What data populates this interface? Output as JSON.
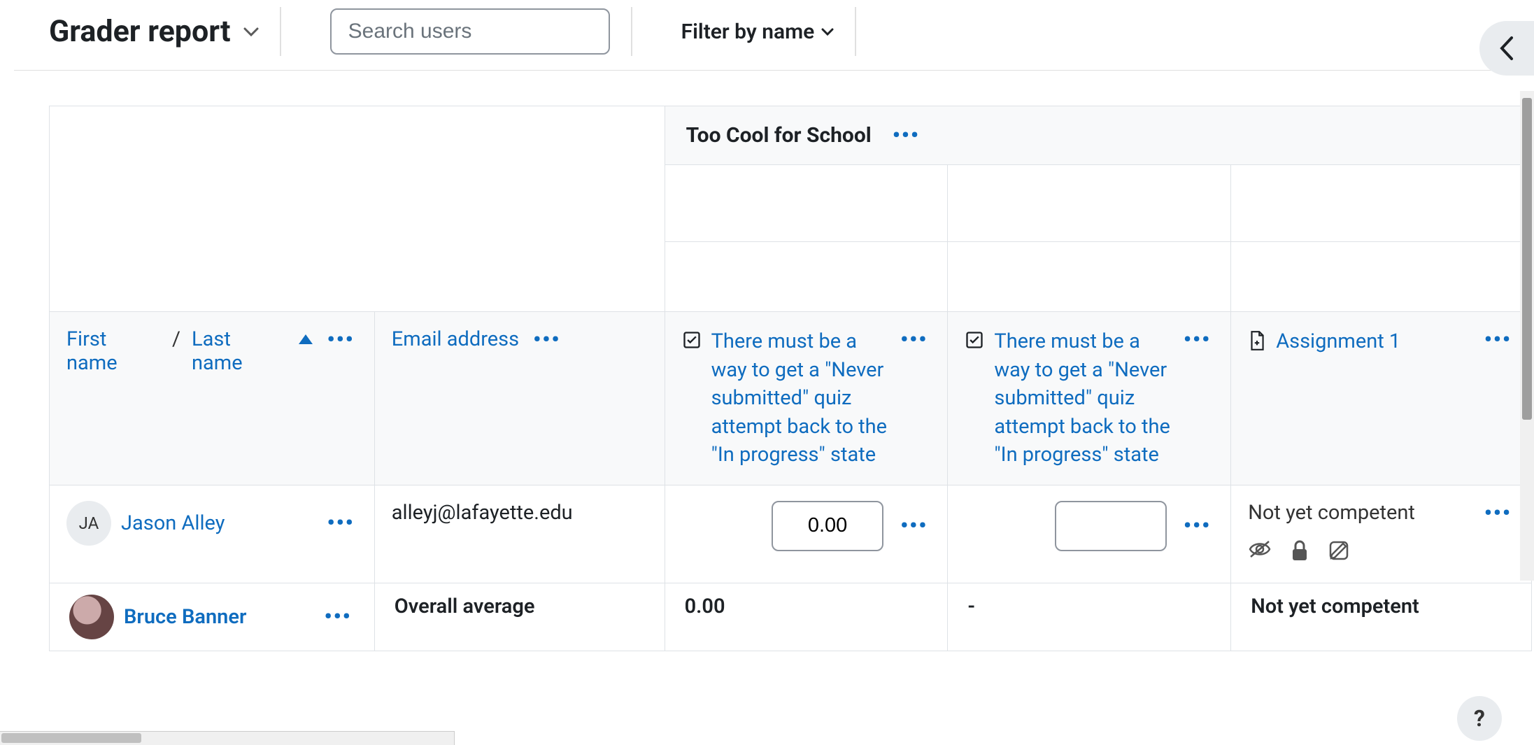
{
  "header": {
    "title": "Grader report",
    "search_placeholder": "Search users",
    "filter_label": "Filter by name"
  },
  "category": {
    "name": "Too Cool for School"
  },
  "columns": {
    "first_name": "First name",
    "separator": "/",
    "last_name": "Last name",
    "email": "Email address",
    "quiz_label": "There must be a way to get a \"Never submitted\" quiz attempt back to the \"In progress\" state",
    "assignment_label": "Assignment 1"
  },
  "rows": [
    {
      "initials": "JA",
      "name": "Jason Alley",
      "email": "alleyj@lafayette.edu",
      "grade1": "0.00",
      "grade2": "",
      "assignment_status": "Not yet competent",
      "has_avatar_image": false
    },
    {
      "initials": "",
      "name": "Bruce Banner",
      "email": "",
      "grade1": "",
      "grade2": "",
      "assignment_status": "",
      "has_avatar_image": true
    }
  ],
  "averages": {
    "label": "Overall average",
    "grade1": "0.00",
    "grade2": "-",
    "assignment": "Not yet competent"
  },
  "help_glyph": "?"
}
